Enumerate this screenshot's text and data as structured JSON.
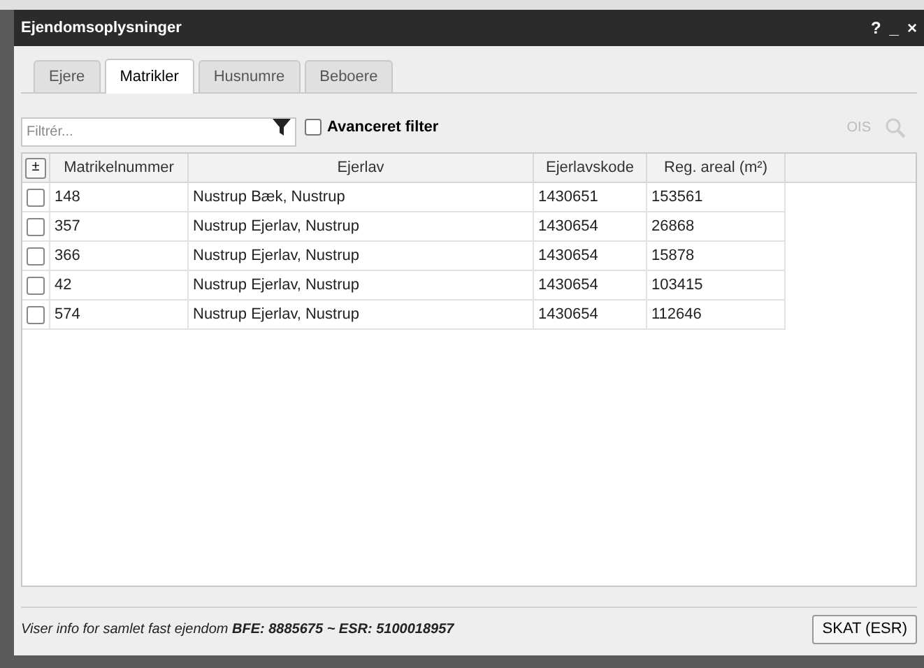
{
  "window": {
    "title": "Ejendomsoplysninger",
    "controls": [
      "?",
      "_",
      "×"
    ]
  },
  "tabs": [
    {
      "label": "Ejere",
      "selected": false
    },
    {
      "label": "Matrikler",
      "selected": true
    },
    {
      "label": "Husnumre",
      "selected": false
    },
    {
      "label": "Beboere",
      "selected": false
    }
  ],
  "filter": {
    "placeholder": "Filtrér...",
    "advanced": {
      "label": "Avanceret filter",
      "checked": false
    }
  },
  "ois": {
    "label": "OIS",
    "disabled": true
  },
  "table": {
    "toggle": "±",
    "columns": [
      "Matrikelnummer",
      "Ejerlav",
      "Ejerlavskode",
      "Reg. areal (m²)"
    ],
    "rows": [
      {
        "checked": false,
        "cells": [
          "148",
          "Nustrup Bæk, Nustrup",
          "1430651",
          "153561"
        ]
      },
      {
        "checked": false,
        "cells": [
          "357",
          "Nustrup Ejerlav, Nustrup",
          "1430654",
          "26868"
        ]
      },
      {
        "checked": false,
        "cells": [
          "366",
          "Nustrup Ejerlav, Nustrup",
          "1430654",
          "15878"
        ]
      },
      {
        "checked": false,
        "cells": [
          "42",
          "Nustrup Ejerlav, Nustrup",
          "1430654",
          "103415"
        ]
      },
      {
        "checked": false,
        "cells": [
          "574",
          "Nustrup Ejerlav, Nustrup",
          "1430654",
          "112646"
        ]
      }
    ]
  },
  "status_bar": {
    "text": "Viser info for samlet fast ejendom **BFE: 8885675 ~ ESR: 5100018957**",
    "button": "SKAT (ESR)"
  }
}
